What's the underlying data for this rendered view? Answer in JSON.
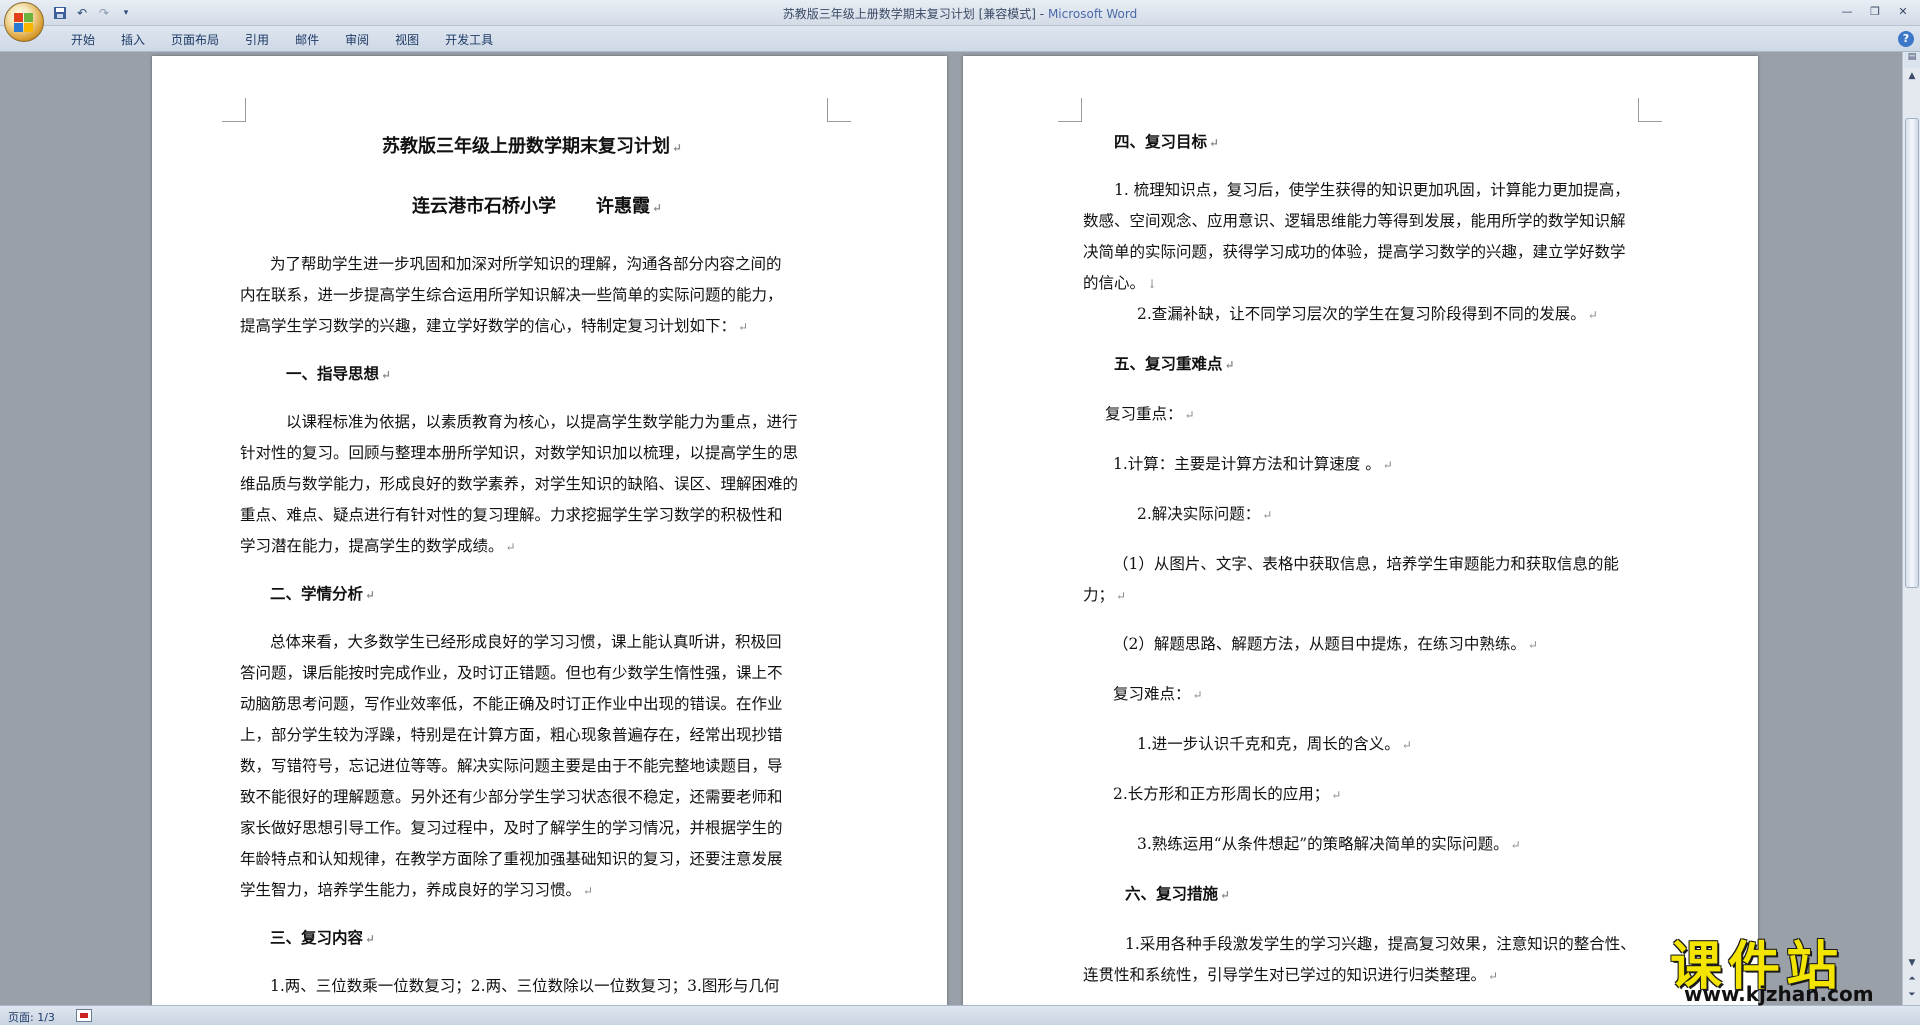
{
  "window": {
    "title": "苏教版三年级上册数学期末复习计划 [兼容模式]",
    "title_sep": " - ",
    "app_name": "Microsoft Word"
  },
  "qat": {
    "save_icon": "save-icon",
    "undo_icon": "undo-icon",
    "redo_icon": "redo-icon",
    "customize_icon": "dropdown-icon"
  },
  "tabs": [
    "开始",
    "插入",
    "页面布局",
    "引用",
    "邮件",
    "审阅",
    "视图",
    "开发工具"
  ],
  "page1": {
    "title": "苏教版三年级上册数学期末复习计划",
    "author_school": "连云港市石桥小学",
    "author_name": "许惠霞",
    "intro": [
      "为了帮助学生进一步巩固和加深对所学知识的理解，沟通各部分内容之间的",
      "内在联系，进一步提高学生综合运用所学知识解决一些简单的实际问题的能力，",
      "提高学生学习数学的兴趣，建立学好数学的信心，特制定复习计划如下："
    ],
    "h1": "一、指导思想",
    "p1": [
      "以课程标准为依据，以素质教育为核心，以提高学生数学能力为重点，进行",
      "针对性的复习。回顾与整理本册所学知识，对数学知识加以梳理，以提高学生的思",
      "维品质与数学能力，形成良好的数学素养，对学生知识的缺陷、误区、理解困难的",
      "重点、难点、疑点进行有针对性的复习理解。力求挖掘学生学习数学的积极性和",
      "学习潜在能力，提高学生的数学成绩。"
    ],
    "h2": "二、学情分析",
    "p2": [
      "总体来看，大多数学生已经形成良好的学习习惯，课上能认真听讲，积极回",
      "答问题，课后能按时完成作业，及时订正错题。但也有少数学生惰性强，课上不",
      "动脑筋思考问题，写作业效率低，不能正确及时订正作业中出现的错误。在作业",
      "上，部分学生较为浮躁，特别是在计算方面，粗心现象普遍存在，经常出现抄错",
      "数，写错符号，忘记进位等等。解决实际问题主要是由于不能完整地读题目，导",
      "致不能很好的理解题意。另外还有少部分学生学习状态很不稳定，还需要老师和",
      "家长做好思想引导工作。复习过程中，及时了解学生的学习情况，并根据学生的",
      "年龄特点和认知规律，在教学方面除了重视加强基础知识的复习，还要注意发展",
      "学生智力，培养学生能力，养成良好的学习习惯。"
    ],
    "h3": "三、复习内容",
    "p3": "1.两、三位数乘一位数复习；2.两、三位数除以一位数复习；3.图形与几何"
  },
  "page2": {
    "h4": "四、复习目标",
    "goal1": [
      "1. 梳理知识点，复习后，使学生获得的知识更加巩固，计算能力更加提高，",
      "数感、空间观念、应用意识、逻辑思维能力等得到发展，能用所学的数学知识解",
      "决简单的实际问题，获得学习成功的体验，提高学习数学的兴趣，建立学好数学",
      "的信心。"
    ],
    "goal2": "2.查漏补缺，让不同学习层次的学生在复习阶段得到不同的发展。",
    "h5": "五、复习重难点",
    "key_label": "复习重点：",
    "key1": "1.计算：主要是计算方法和计算速度 。",
    "key2": "2.解决实际问题：",
    "key2a": [
      "（1）从图片、文字、表格中获取信息，培养学生审题能力和获取信息的能",
      "力；"
    ],
    "key2b": "（2）解题思路、解题方法，从题目中提炼，在练习中熟练。",
    "diff_label": "复习难点：",
    "diff1": "1.进一步认识千克和克，周长的含义。",
    "diff2": "2.长方形和正方形周长的应用；",
    "diff3": "3.熟练运用“从条件想起”的策略解决简单的实际问题。",
    "h6": "六、复习措施",
    "m1": [
      "1.采用各种手段激发学生的学习兴趣，提高复习效果，注意知识的整合性、",
      "连贯性和系统性，引导学生对已学过的知识进行归类整理。"
    ]
  },
  "status": {
    "page_label": "页面: 1/3"
  },
  "watermark": {
    "title": "课件站",
    "url": "www.kjzhan.com"
  },
  "colors": {
    "workspace": "#9aa0a8",
    "ribbon": "#cfd9e6",
    "watermark_yellow": "#f3e500"
  }
}
